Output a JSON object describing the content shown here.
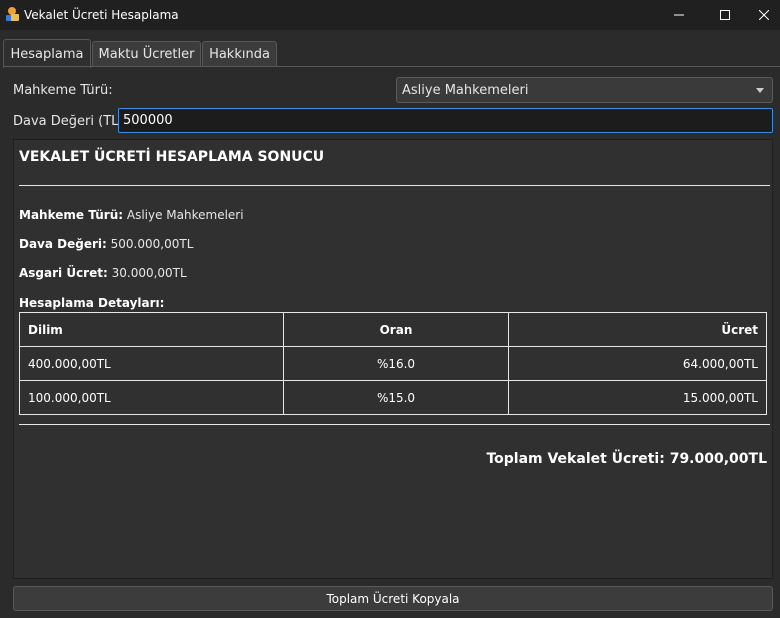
{
  "window": {
    "title": "Vekalet Ücreti Hesaplama",
    "minimize": "—",
    "maximize": "☐",
    "close": "✕"
  },
  "tabs": [
    "Hesaplama",
    "Maktu Ücretler",
    "Hakkında"
  ],
  "form": {
    "court_label": "Mahkeme Türü:",
    "court_value": "Asliye Mahkemeleri",
    "value_label": "Dava Değeri (TL):",
    "value_input": "500000"
  },
  "result": {
    "title": "VEKALET ÜCRETİ HESAPLAMA SONUCU",
    "court_key": "Mahkeme Türü:",
    "court_val": "Asliye Mahkemeleri",
    "value_key": "Dava Değeri:",
    "value_val": "500.000,00TL",
    "min_key": "Asgari Ücret:",
    "min_val": "30.000,00TL",
    "details_label": "Hesaplama Detayları:",
    "table": {
      "headers": [
        "Dilim",
        "Oran",
        "Ücret"
      ],
      "rows": [
        [
          "400.000,00TL",
          "%16.0",
          "64.000,00TL"
        ],
        [
          "100.000,00TL",
          "%15.0",
          "15.000,00TL"
        ]
      ]
    },
    "total": "Toplam Vekalet Ücreti: 79.000,00TL"
  },
  "copy_button": "Toplam Ücreti Kopyala",
  "colors": {
    "background": "#2b2b2b",
    "titlebar": "#202020",
    "focus_border": "#3d8ee0"
  }
}
